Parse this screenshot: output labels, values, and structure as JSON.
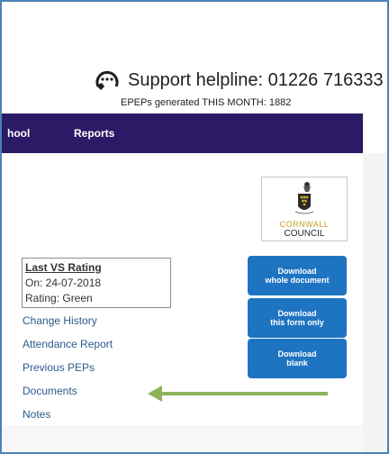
{
  "header": {
    "helpline": "Support helpline: 01226 716333",
    "epeps": "EPEPs generated THIS MONTH: 1882"
  },
  "nav": {
    "items": [
      "hool",
      "Reports"
    ]
  },
  "logo": {
    "line1": "CORNWALL",
    "line2": "COUNCIL"
  },
  "rating": {
    "title": "Last VS Rating",
    "date": "On: 24-07-2018",
    "value": "Rating: Green"
  },
  "links": [
    "Change History",
    "Attendance Report",
    "Previous PEPs",
    "Documents",
    "Notes"
  ],
  "buttons": {
    "download_whole": [
      "Download",
      "whole document"
    ],
    "download_form": [
      "Download",
      "this form only"
    ],
    "download_blank": [
      "Download",
      "blank"
    ]
  },
  "colors": {
    "nav_bg": "#2b1a66",
    "button_bg": "#1f74c2",
    "link": "#2a5b8c",
    "arrow": "#8db35a"
  }
}
